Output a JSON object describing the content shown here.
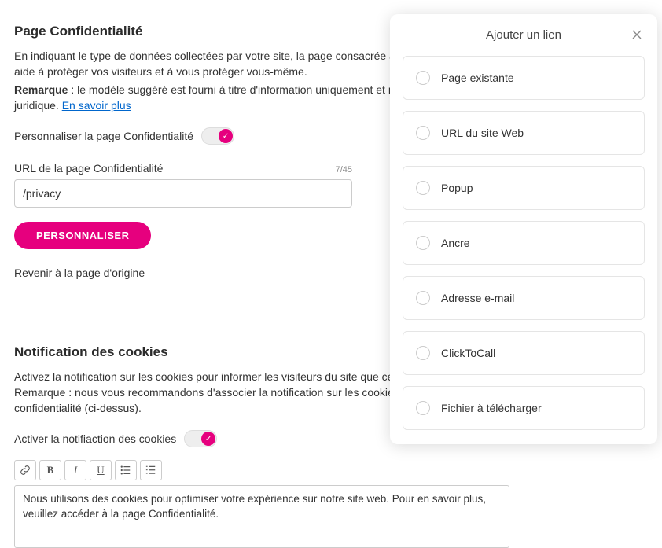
{
  "privacy": {
    "title": "Page Confidentialité",
    "intro": "En indiquant le type de données collectées par votre site, la page consacrée à la confidentialité vous aide à protéger vos visiteurs et à vous protéger vous-même.",
    "note_label": "Remarque",
    "note_text": " : le modèle suggéré est fourni à titre d'information uniquement et n'a aucune valeur juridique. ",
    "learn_more": "En savoir plus",
    "toggle_label": "Personnaliser la page Confidentialité",
    "url_label": "URL de la page Confidentialité",
    "url_counter": "7/45",
    "url_value": "/privacy",
    "customize_btn": "PERSONNALISER",
    "reset_link": "Revenir à la page d'origine"
  },
  "cookies": {
    "title": "Notification des cookies",
    "intro": "Activez la notification sur les cookies pour informer les visiteurs du site que celui-ci en utilise. Remarque : nous vous recommandons d'associer la notification sur les cookies à votre page de confidentialité (ci-dessus).",
    "toggle_label": "Activer la notifiaction des cookies",
    "toolbar": {
      "link": "link-icon",
      "bold": "B",
      "italic": "I",
      "underline": "U",
      "ul": "bullet-list-icon",
      "ol": "numbered-list-icon"
    },
    "editor_text": "Nous utilisons des cookies pour optimiser votre expérience sur notre site web. Pour en savoir plus, veuillez accéder à la page Confidentialité."
  },
  "panel": {
    "title": "Ajouter un lien",
    "options": [
      "Page existante",
      "URL du site Web",
      "Popup",
      "Ancre",
      "Adresse e-mail",
      "ClickToCall",
      "Fichier à télécharger"
    ]
  }
}
